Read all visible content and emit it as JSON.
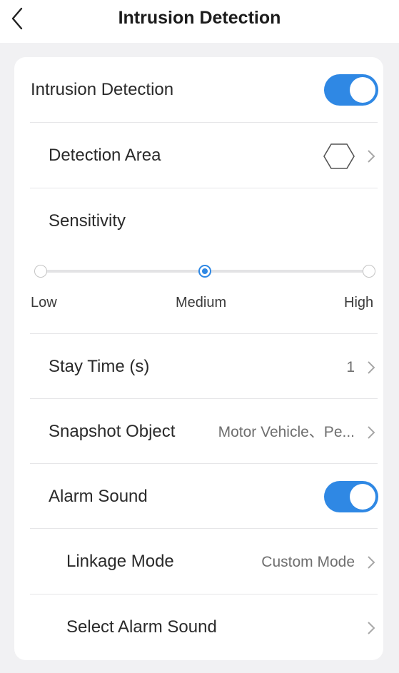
{
  "header": {
    "title": "Intrusion Detection",
    "back_icon": "chevron-left-icon"
  },
  "settings": {
    "intrusion_detection": {
      "label": "Intrusion Detection",
      "enabled": true
    },
    "detection_area": {
      "label": "Detection Area",
      "icon": "hexagon-icon"
    },
    "sensitivity": {
      "label": "Sensitivity",
      "options": [
        "Low",
        "Medium",
        "High"
      ],
      "selected": "Medium"
    },
    "stay_time": {
      "label": "Stay Time (s)",
      "value": "1"
    },
    "snapshot_object": {
      "label": "Snapshot Object",
      "value": "Motor Vehicle、Pe..."
    },
    "alarm_sound": {
      "label": "Alarm Sound",
      "enabled": true
    },
    "linkage_mode": {
      "label": "Linkage Mode",
      "value": "Custom Mode"
    },
    "select_alarm_sound": {
      "label": "Select Alarm Sound"
    }
  },
  "colors": {
    "accent": "#2f88e4",
    "background": "#f1f1f3",
    "card": "#ffffff"
  }
}
